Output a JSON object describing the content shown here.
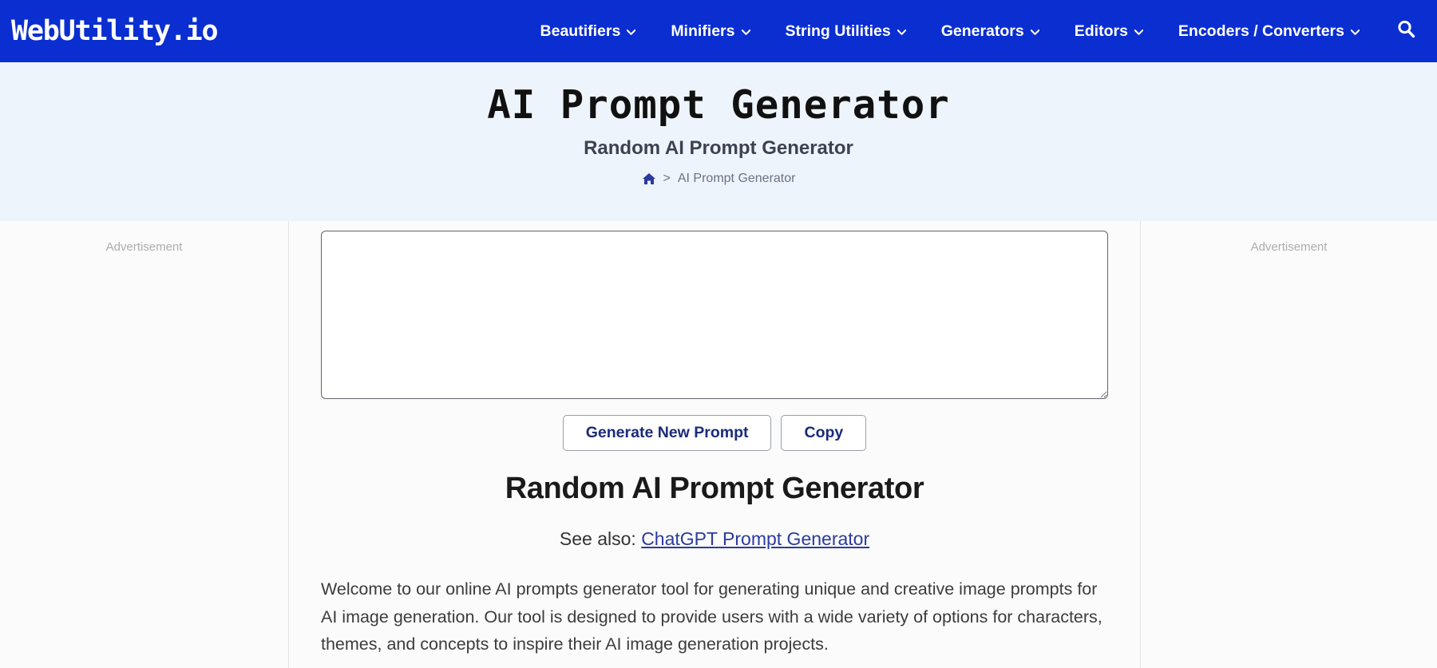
{
  "header": {
    "logo": "WebUtility.io",
    "nav_items": [
      {
        "label": "Beautifiers",
        "icon": "chevron-down-icon"
      },
      {
        "label": "Minifiers",
        "icon": "chevron-down-icon"
      },
      {
        "label": "String Utilities",
        "icon": "chevron-down-icon"
      },
      {
        "label": "Generators",
        "icon": "chevron-down-icon"
      },
      {
        "label": "Editors",
        "icon": "chevron-down-icon"
      },
      {
        "label": "Encoders / Converters",
        "icon": "chevron-down-icon"
      }
    ],
    "search_icon": "search-icon",
    "bg_color": "#0a2ed0"
  },
  "hero": {
    "title": "AI Prompt Generator",
    "subtitle": "Random AI Prompt Generator",
    "bg_color": "#eef4fc",
    "breadcrumb": {
      "home_icon": "home-icon",
      "separator": ">",
      "current": "AI Prompt Generator"
    }
  },
  "ads": {
    "left_label": "Advertisement",
    "right_label": "Advertisement"
  },
  "main": {
    "prompt_textarea": {
      "value": "",
      "placeholder": ""
    },
    "buttons": {
      "generate": "Generate New Prompt",
      "copy": "Copy"
    },
    "heading": "Random AI Prompt Generator",
    "see_also_label": "See also:",
    "see_also_link": "ChatGPT Prompt Generator",
    "intro_paragraph": "Welcome to our online AI prompts generator tool for generating unique and creative image prompts for AI image generation. Our tool is designed to provide users with a wide variety of options for characters, themes, and concepts to inspire their AI image generation projects.",
    "link_color": "#2b3b9e"
  }
}
